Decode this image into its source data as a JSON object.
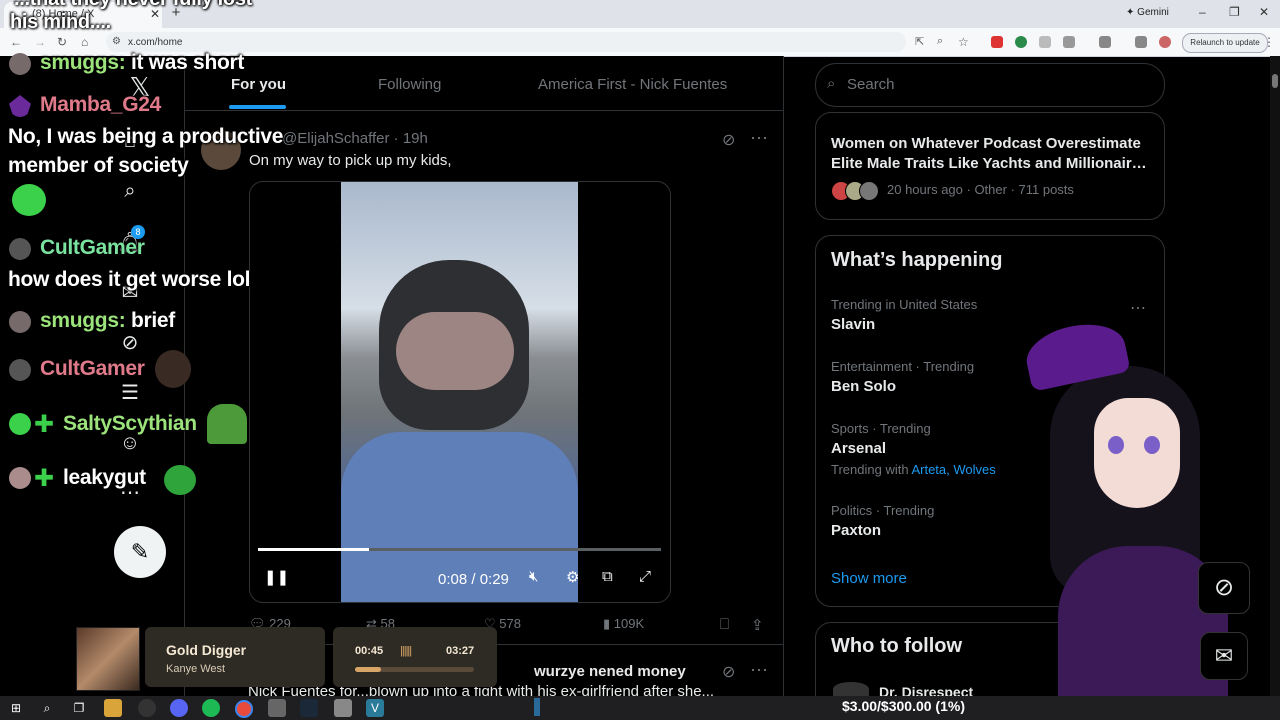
{
  "browser": {
    "tab_title": "(8) Home / X",
    "tab_close": "✕",
    "new_tab": "+",
    "gemini_label": "Gemini",
    "url": "x.com/home",
    "relaunch_label": "Relaunch to update"
  },
  "x_logo": "𝕏",
  "feed": {
    "tabs": [
      "For you",
      "Following",
      "America First - Nick Fuentes"
    ],
    "post": {
      "handle": "@ElijahSchaffer · 19h",
      "text": "On my way to pick up my kids,",
      "video": {
        "time": "0:08 / 0:29",
        "progress": 0.276
      },
      "stats": {
        "replies": "229",
        "reposts": "58",
        "likes": "578",
        "views": "109K"
      }
    },
    "next_post": {
      "name": "wurzye nened money",
      "text": "Nick Fuentes for...blown up into a fight with his ex-girlfriend after she..."
    }
  },
  "notification_count": "8",
  "sidebar": {
    "search_placeholder": "Search",
    "news": {
      "title": "Women on Whatever Podcast Overestimate Elite Male Traits Like Yachts and Millionair…",
      "meta": "20 hours ago · Other · 711 posts"
    },
    "whats_happening": {
      "title": "What’s happening",
      "trends": [
        {
          "category": "Trending in United States",
          "name": "Slavin"
        },
        {
          "category": "Entertainment · Trending",
          "name": "Ben Solo"
        },
        {
          "category": "Sports · Trending",
          "name": "Arsenal"
        },
        {
          "category": "Politics · Trending",
          "name": "Paxton"
        }
      ],
      "trending_with_label": "Trending with",
      "trending_with_links": [
        "Arteta,",
        "Wolves"
      ],
      "show_more": "Show more"
    },
    "who_to_follow": {
      "title": "Who to follow",
      "first": "Dr. Disrespect"
    }
  },
  "chat": {
    "top_line_1": "...that they never fully lost",
    "top_line_2": "his mind....",
    "messages": [
      {
        "user": "smuggs:",
        "text": "it was short",
        "color": "#9be37a"
      },
      {
        "user": "Mamba_G24",
        "text": "",
        "color": "#e07a8a"
      },
      {
        "user": "",
        "text": "No, I was being a productive",
        "color": "#ffffff"
      },
      {
        "user": "",
        "text": "member of society",
        "color": "#ffffff"
      },
      {
        "user": "CultGamer",
        "text": "",
        "color": "#7be3a0"
      },
      {
        "user": "",
        "text": "how does it get worse lol",
        "color": "#ffffff"
      },
      {
        "user": "smuggs:",
        "text": "brief",
        "color": "#9be37a"
      },
      {
        "user": "CultGamer",
        "text": "",
        "color": "#e07a8a"
      },
      {
        "user": "SaltyScythian",
        "text": "",
        "color": "#9be37a"
      },
      {
        "user": "leakygut",
        "text": "",
        "color": "#ffffff"
      }
    ]
  },
  "music": {
    "title": "Gold Digger",
    "artist": "Kanye West",
    "elapsed": "00:45",
    "total": "03:27",
    "progress": 0.217
  },
  "taskbar": {
    "donation": "$3.00/$300.00 (1%)"
  },
  "colors": {
    "accent": "#1d9bf0",
    "background": "#000000",
    "border": "#2f3336",
    "muted_text": "#71767b"
  }
}
